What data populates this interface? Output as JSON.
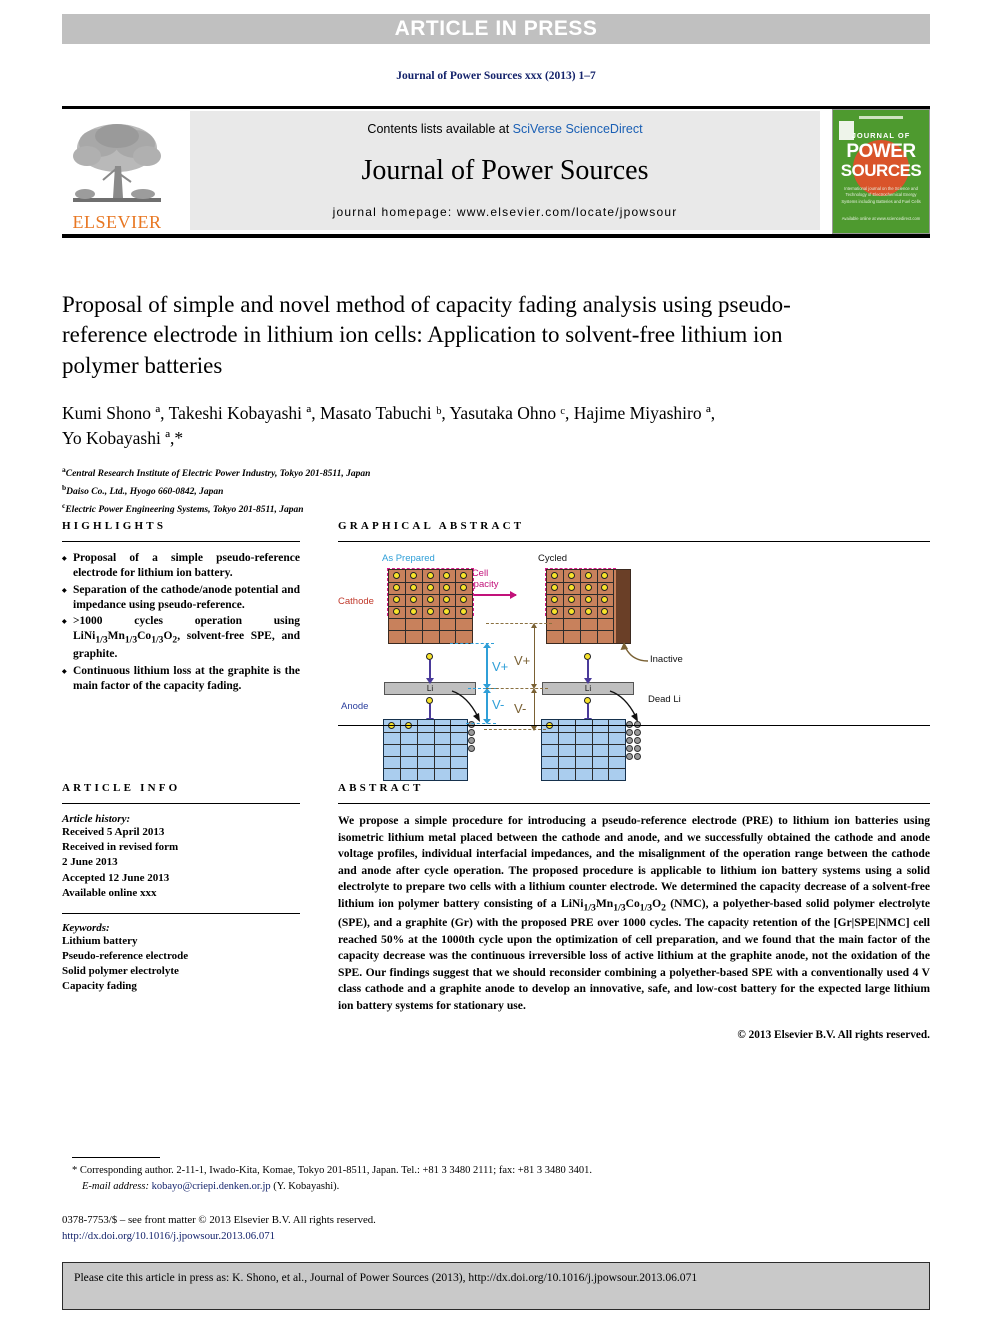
{
  "banner": {
    "text": "ARTICLE IN PRESS"
  },
  "running_head": "Journal of Power Sources xxx (2013) 1–7",
  "masthead": {
    "contents_prefix": "Contents lists available at ",
    "contents_link": "SciVerse ScienceDirect",
    "journal_title": "Journal of Power Sources",
    "homepage": "journal homepage: www.elsevier.com/locate/jpowsour",
    "publisher_wordmark": "ELSEVIER",
    "cover": {
      "journal_of": "JOURNAL OF",
      "power": "POWER",
      "sources": "SOURCES",
      "subtitle": "International journal on the Science and Technology of Electrochemical Energy Systems including Batteries and Fuel Cells",
      "footer": "Available online at www.sciencedirect.com"
    }
  },
  "article": {
    "title": "Proposal of simple and novel method of capacity fading analysis using pseudo-reference electrode in lithium ion cells: Application to solvent-free lithium ion polymer batteries",
    "authors_line1": "Kumi Shono ª, Takeshi Kobayashi ª, Masato Tabuchi ᵇ, Yasutaka Ohno ᶜ, Hajime Miyashiro ª,",
    "authors_line2": "Yo Kobayashi ª,*",
    "affiliations": [
      {
        "mark": "a",
        "text": "Central Research Institute of Electric Power Industry, Tokyo 201-8511, Japan"
      },
      {
        "mark": "b",
        "text": "Daiso Co., Ltd., Hyogo 660-0842, Japan"
      },
      {
        "mark": "c",
        "text": "Electric Power Engineering Systems, Tokyo 201-8511, Japan"
      }
    ]
  },
  "highlights": {
    "heading": "HIGHLIGHTS",
    "items": [
      "Proposal of a simple pseudo-reference electrode for lithium ion battery.",
      "Separation of the cathode/anode potential and impedance using pseudo-reference.",
      ">1000 cycles operation using LiNi1/3Mn1/3Co1/3O2, solvent-free SPE, and graphite.",
      "Continuous lithium loss at the graphite is the main factor of the capacity fading."
    ]
  },
  "graphical_abstract": {
    "heading": "GRAPHICAL ABSTRACT",
    "labels": {
      "as_prepared": "As Prepared",
      "cycled": "Cycled",
      "cathode": "Cathode",
      "anode": "Anode",
      "cell_capacity_l1": "Cell",
      "cell_capacity_l2": "Capacity",
      "inactive": "Inactive",
      "dead_li": "Dead Li",
      "li_bar": "Li",
      "v_plus_blue": "V+",
      "v_minus_blue": "V-",
      "v_plus_brown": "V+",
      "v_minus_brown": "V-"
    },
    "colors": {
      "cathode_fill": "#c8815c",
      "cathode_inactive": "#6a3f27",
      "anode_fill": "#aacdee",
      "lithium_dot": "#f7e32b",
      "dead_li_dot": "#9a9a9a",
      "cell_capacity_arrow": "#c2127a",
      "v_blue": "#2f9fd8",
      "v_brown": "#7a6134"
    }
  },
  "article_info": {
    "heading": "ARTICLE INFO",
    "history_label": "Article history:",
    "history_lines": [
      "Received 5 April 2013",
      "Received in revised form",
      "2 June 2013",
      "Accepted 12 June 2013",
      "Available online xxx"
    ],
    "keywords_label": "Keywords:",
    "keywords": [
      "Lithium battery",
      "Pseudo-reference electrode",
      "Solid polymer electrolyte",
      "Capacity fading"
    ]
  },
  "abstract": {
    "heading": "ABSTRACT",
    "body": "We propose a simple procedure for introducing a pseudo-reference electrode (PRE) to lithium ion batteries using isometric lithium metal placed between the cathode and anode, and we successfully obtained the cathode and anode voltage profiles, individual interfacial impedances, and the misalignment of the operation range between the cathode and anode after cycle operation. The proposed procedure is applicable to lithium ion battery systems using a solid electrolyte to prepare two cells with a lithium counter electrode. We determined the capacity decrease of a solvent-free lithium ion polymer battery consisting of a LiNi1/3Mn1/3Co1/3O2 (NMC), a polyether-based solid polymer electrolyte (SPE), and a graphite (Gr) with the proposed PRE over 1000 cycles. The capacity retention of the [Gr|SPE|NMC] cell reached 50% at the 1000th cycle upon the optimization of cell preparation, and we found that the main factor of the capacity decrease was the continuous irreversible loss of active lithium at the graphite anode, not the oxidation of the SPE. Our findings suggest that we should reconsider combining a polyether-based SPE with a conventionally used 4 V class cathode and a graphite anode to develop an innovative, safe, and low-cost battery for the expected large lithium ion battery systems for stationary use.",
    "copyright": "© 2013 Elsevier B.V. All rights reserved."
  },
  "footnotes": {
    "corresponding": "* Corresponding author. 2-11-1, Iwado-Kita, Komae, Tokyo 201-8511, Japan. Tel.: +81 3 3480 2111; fax: +81 3 3480 3401.",
    "email_label": "E-mail address:",
    "email": "kobayo@criepi.denken.or.jp",
    "email_owner": "(Y. Kobayashi).",
    "issn_line": "0378-7753/$ – see front matter © 2013 Elsevier B.V. All rights reserved.",
    "doi": "http://dx.doi.org/10.1016/j.jpowsour.2013.06.071"
  },
  "cite_box": {
    "text": "Please cite this article in press as: K. Shono, et al., Journal of Power Sources (2013), http://dx.doi.org/10.1016/j.jpowsour.2013.06.071"
  }
}
